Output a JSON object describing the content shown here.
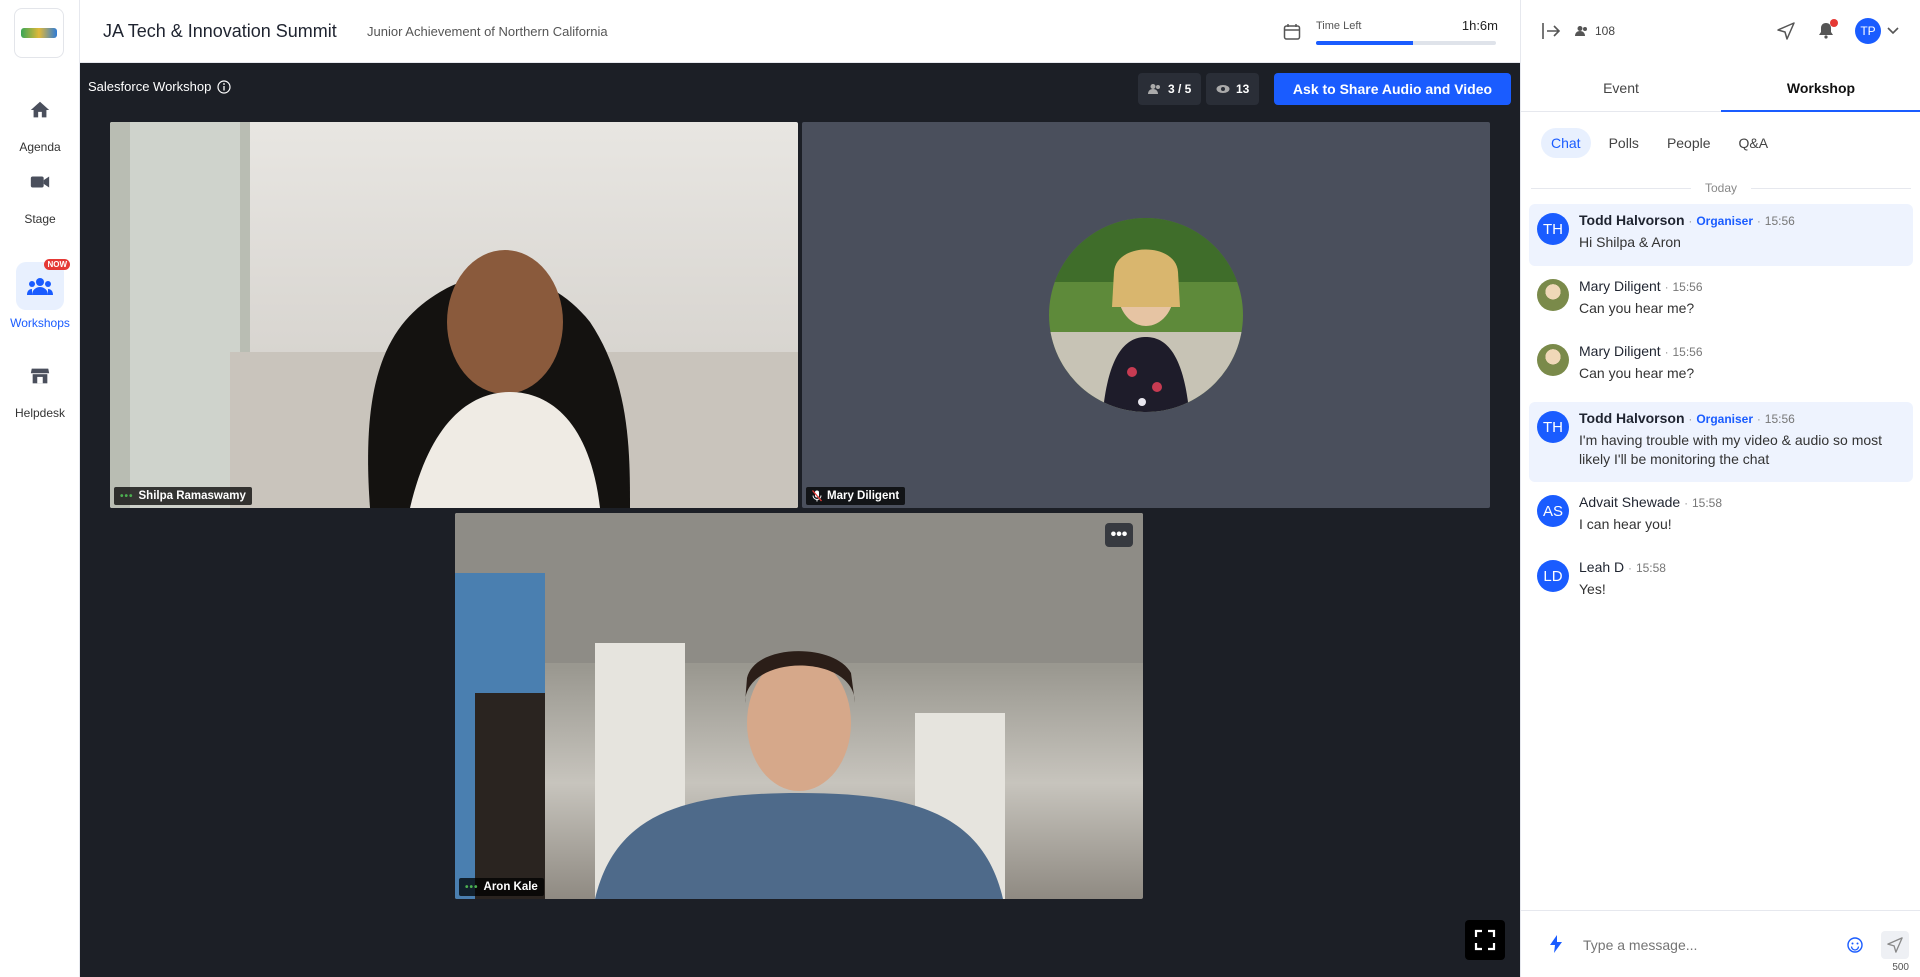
{
  "nav": {
    "items": [
      {
        "label": "Agenda"
      },
      {
        "label": "Stage"
      },
      {
        "label": "Workshops",
        "badge": "NOW"
      },
      {
        "label": "Helpdesk"
      }
    ]
  },
  "header": {
    "title": "JA Tech & Innovation Summit",
    "org": "Junior Achievement of Northern California",
    "time_left_label": "Time Left",
    "time_left_value": "1h:6m",
    "time_left_progress": 0.54
  },
  "stage": {
    "workshop_title": "Salesforce Workshop",
    "seats": "3 / 5",
    "viewers": "13",
    "share_button": "Ask to Share Audio and Video",
    "tiles": [
      {
        "name": "Shilpa Ramaswamy"
      },
      {
        "name": "Mary Diligent"
      },
      {
        "name": "Aron Kale"
      }
    ]
  },
  "panel": {
    "attendee_count": "108",
    "user_initials": "TP",
    "tabs": [
      {
        "label": "Event"
      },
      {
        "label": "Workshop"
      }
    ],
    "subtabs": [
      {
        "label": "Chat"
      },
      {
        "label": "Polls"
      },
      {
        "label": "People"
      },
      {
        "label": "Q&A"
      }
    ],
    "day_separator": "Today",
    "messages": [
      {
        "initials": "TH",
        "name": "Todd Halvorson",
        "role": "Organiser",
        "time": "15:56",
        "text": "Hi Shilpa & Aron"
      },
      {
        "initials": "",
        "name": "Mary Diligent",
        "role": "",
        "time": "15:56",
        "text": "Can you hear me?"
      },
      {
        "initials": "",
        "name": "Mary Diligent",
        "role": "",
        "time": "15:56",
        "text": "Can you hear me?"
      },
      {
        "initials": "TH",
        "name": "Todd Halvorson",
        "role": "Organiser",
        "time": "15:56",
        "text": "I'm having trouble with my video & audio so most likely I'll be monitoring the chat"
      },
      {
        "initials": "AS",
        "name": "Advait Shewade",
        "role": "",
        "time": "15:58",
        "text": "I can hear you!"
      },
      {
        "initials": "LD",
        "name": "Leah D",
        "role": "",
        "time": "15:58",
        "text": "Yes!"
      }
    ],
    "composer_placeholder": "Type a message...",
    "char_limit": "500"
  },
  "colors": {
    "accent": "#1a5cff",
    "stage_bg": "#1c1f26",
    "notification": "#e53935"
  }
}
